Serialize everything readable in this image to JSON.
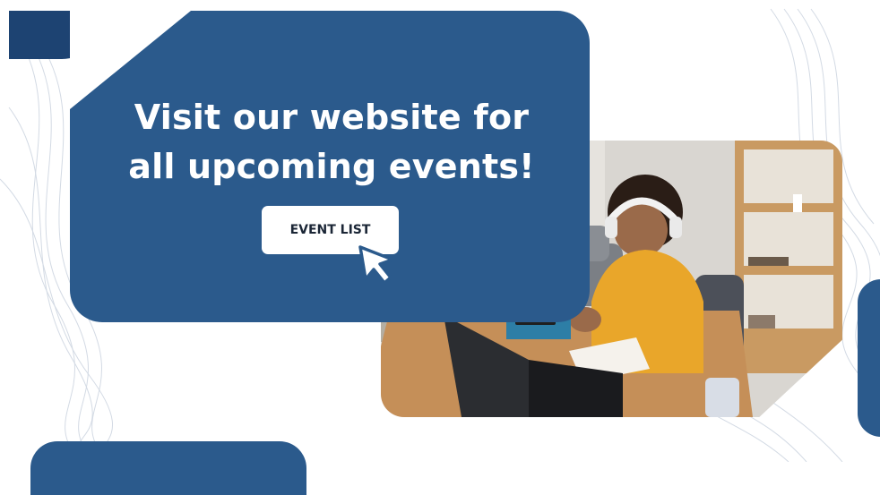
{
  "banner": {
    "headline_line1": "Visit our website for",
    "headline_line2": "all upcoming events!",
    "cta_label": "EVENT LIST"
  },
  "icons": {
    "cursor": "pointer-cursor-icon"
  },
  "colors": {
    "primary_blue": "#2b5a8c",
    "dark_blue": "#1d4372",
    "sweater_yellow": "#e9a62a",
    "button_bg": "#ffffff"
  }
}
